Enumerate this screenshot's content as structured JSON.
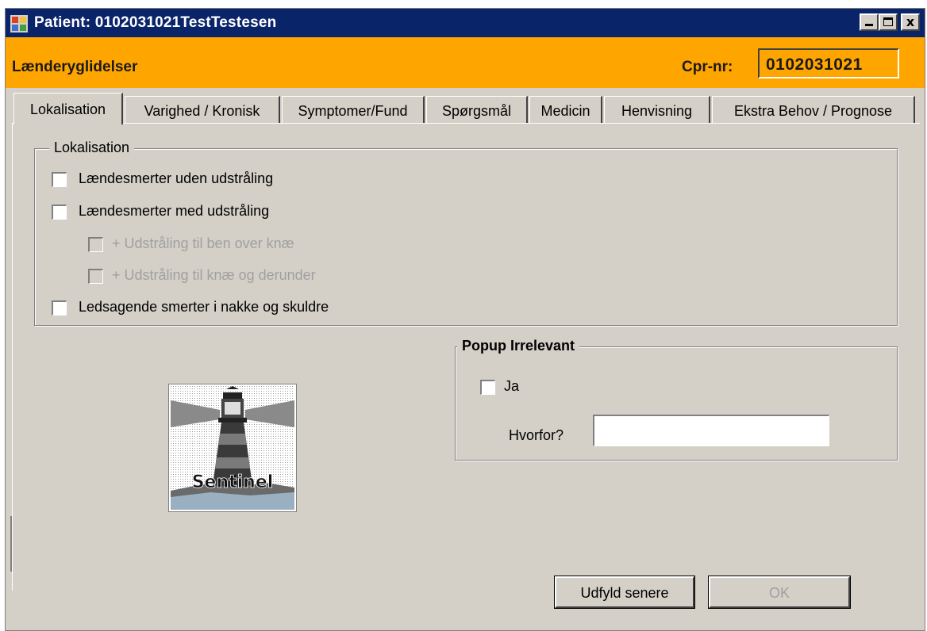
{
  "window": {
    "title": "Patient: 0102031021TestTestesen",
    "controls": [
      "minimize",
      "maximize",
      "close"
    ],
    "close_glyph": "x"
  },
  "header": {
    "title": "Lænderyglidelser",
    "cpr_label": "Cpr-nr:",
    "cpr_value": "0102031021"
  },
  "tabs": [
    {
      "label": "Lokalisation",
      "active": true
    },
    {
      "label": "Varighed / Kronisk",
      "active": false
    },
    {
      "label": "Symptomer/Fund",
      "active": false
    },
    {
      "label": "Spørgsmål",
      "active": false
    },
    {
      "label": "Medicin",
      "active": false
    },
    {
      "label": "Henvisning",
      "active": false
    },
    {
      "label": "Ekstra Behov / Prognose",
      "active": false
    }
  ],
  "lokalisation": {
    "legend": "Lokalisation",
    "items": [
      {
        "label": "Lændesmerter uden udstråling",
        "checked": false,
        "enabled": true
      },
      {
        "label": "Lændesmerter med udstråling",
        "checked": false,
        "enabled": true
      },
      {
        "label": "+ Udstråling til ben over knæ",
        "checked": false,
        "enabled": false
      },
      {
        "label": "+ Udstråling til knæ og derunder",
        "checked": false,
        "enabled": false
      },
      {
        "label": "Ledsagende smerter i nakke og skuldre",
        "checked": false,
        "enabled": true
      }
    ]
  },
  "popup": {
    "legend": "Popup Irrelevant",
    "ja_label": "Ja",
    "ja_checked": false,
    "why_label": "Hvorfor?",
    "why_value": ""
  },
  "logo": {
    "text": "Sentinel"
  },
  "buttons": {
    "later": "Udfyld senere",
    "ok": "OK"
  },
  "colors": {
    "titlebar": "#0a246a",
    "header": "#ffa500",
    "face": "#d4d0c8"
  }
}
